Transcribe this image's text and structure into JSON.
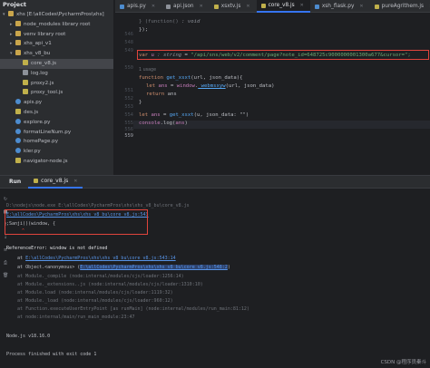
{
  "project": {
    "title": "Project",
    "items": [
      {
        "label": "xhs [E:\\allCodes\\PycharmPros\\xhs]",
        "icon": "folder-icon",
        "indent": 0,
        "chevron": "down"
      },
      {
        "label": "node_modules  library root",
        "icon": "folder-icon",
        "indent": 1,
        "chevron": "right"
      },
      {
        "label": "venv  library root",
        "icon": "folder-icon",
        "indent": 1,
        "chevron": "right"
      },
      {
        "label": "xhs_api_v1",
        "icon": "folder-icon",
        "indent": 1,
        "chevron": "right"
      },
      {
        "label": "xhs_v8_bu",
        "icon": "folder-icon",
        "indent": 1,
        "chevron": "down"
      },
      {
        "label": "core_v8.js",
        "icon": "js-file-icon",
        "indent": 2,
        "chevron": "",
        "selected": true
      },
      {
        "label": "log.log",
        "icon": "file-icon",
        "indent": 2,
        "chevron": ""
      },
      {
        "label": "proxy2.js",
        "icon": "js-file-icon",
        "indent": 2,
        "chevron": ""
      },
      {
        "label": "proxy_tool.js",
        "icon": "js-file-icon",
        "indent": 2,
        "chevron": ""
      },
      {
        "label": "apis.py",
        "icon": "python-file-icon",
        "indent": 1,
        "chevron": ""
      },
      {
        "label": "des.js",
        "icon": "js-file-icon",
        "indent": 1,
        "chevron": ""
      },
      {
        "label": "explore.py",
        "icon": "python-file-icon",
        "indent": 1,
        "chevron": ""
      },
      {
        "label": "formatLineNum.py",
        "icon": "python-file-icon",
        "indent": 1,
        "chevron": ""
      },
      {
        "label": "homePage.py",
        "icon": "python-file-icon",
        "indent": 1,
        "chevron": ""
      },
      {
        "label": "kler.py",
        "icon": "python-file-icon",
        "indent": 1,
        "chevron": ""
      },
      {
        "label": "navigator-node.js",
        "icon": "js-file-icon",
        "indent": 1,
        "chevron": ""
      }
    ]
  },
  "tabs": [
    {
      "label": "apis.py",
      "icon": "python-file-icon",
      "active": false
    },
    {
      "label": "api.json",
      "icon": "file-icon",
      "active": false
    },
    {
      "label": "xsxtv.js",
      "icon": "js-file-icon",
      "active": false
    },
    {
      "label": "core_v8.js",
      "icon": "js-file-icon",
      "active": true
    },
    {
      "label": "xsh_flask.py",
      "icon": "python-file-icon",
      "active": false
    },
    {
      "label": "pureAgrithem.js",
      "icon": "js-file-icon",
      "active": false
    }
  ],
  "editor": {
    "line_numbers": [
      "546",
      "548",
      "549",
      "550",
      "551",
      "552",
      "553",
      "554",
      "555",
      "556",
      "557",
      "558",
      "559"
    ],
    "current_line": "559",
    "code": {
      "l546_a": "} (function() ",
      "l546_b": ": void",
      "l548": "});",
      "l550_kw": "var",
      "l550_name": "u",
      "l550_type": ": string",
      "l550_eq": " = ",
      "l550_str": "\"/api/sns/web/v2/comment/page?note_id=648725c9000000001300a677&cursor=\";",
      "usages": "1 usage",
      "l551_kw": "function",
      "l551_fn": "get_xsxt",
      "l551_rest": "(url, json_data){",
      "l552_kw": "let",
      "l552_var": "ans",
      "l552_eq": " = ",
      "l552_fn": "window",
      "l552_dot": ".",
      "l552_call": "_webmsxyw",
      "l552_args": "(url, json_data)",
      "l553_kw": "return",
      "l553_rest": " ans",
      "l554": "}",
      "l556_kw": "let",
      "l556_var": "ans",
      "l556_eq": " = ",
      "l556_fn": "get_xsxt",
      "l556_args": "(u, json_data: \"\")",
      "l557_a": "console",
      "l557_b": ".log(",
      "l557_c": "ans",
      "l557_d": ")"
    }
  },
  "run": {
    "title": "Run",
    "tab_label": "core_v8.js",
    "tools": [
      "rerun-icon",
      "stop-icon",
      "up-icon",
      "down-icon",
      "wrap-icon",
      "print-icon",
      "trash-icon"
    ],
    "lines": {
      "cmd": "D:\\nodejs\\node.exe E:\\allCodes\\PycharmPros\\xhs\\xhs_v8_bu\\core_v8.js",
      "path1": "E:\\allCodes\\PycharmPros\\xhs\\xhs_v8_bu\\core_v8.js:543",
      "code1": ";Sanji()(window, {",
      "caret": "^",
      "err": "ReferenceError: window is not defined",
      "at1_a": "    at ",
      "at1_link": "E:\\allCodes\\PycharmPros\\xhs\\xhs_v8_bu\\core_v8.js:543:14",
      "at2_a": "    at Object.<anonymous> (",
      "at2_link": "E:\\allCodes\\PycharmPros\\xhs\\xhs_v8_bu\\core_v8.js:548:2",
      "at2_b": ")",
      "at3": "    at Module._compile (node:internal/modules/cjs/loader:1256:14)",
      "at4": "    at Module._extensions..js (node:internal/modules/cjs/loader:1310:10)",
      "at5": "    at Module.load (node:internal/modules/cjs/loader:1119:32)",
      "at6": "    at Module._load (node:internal/modules/cjs/loader:960:12)",
      "at7": "    at Function.executeUserEntryPoint [as runMain] (node:internal/modules/run_main:81:12)",
      "at8": "    at node:internal/main/run_main_module:23:47",
      "node": "Node.js v18.16.0",
      "exit": "Process finished with exit code 1"
    }
  },
  "watermark": "CSDN @程序员秦斗",
  "colors": {
    "accent": "#3574f0",
    "highlight_box": "#e0443c",
    "link": "#5794e8"
  }
}
